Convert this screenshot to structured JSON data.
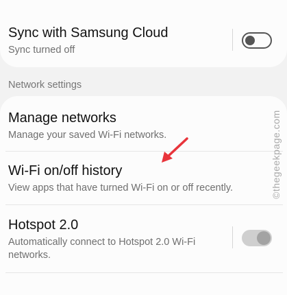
{
  "sync": {
    "title": "Sync with Samsung Cloud",
    "subtitle": "Sync turned off",
    "enabled": false
  },
  "network_section": {
    "header": "Network settings"
  },
  "items": [
    {
      "title": "Manage networks",
      "subtitle": "Manage your saved Wi-Fi networks."
    },
    {
      "title": "Wi-Fi on/off history",
      "subtitle": "View apps that have turned Wi-Fi on or off recently."
    },
    {
      "title": "Hotspot 2.0",
      "subtitle_line1": "Automatically connect to Hotspot 2.0 Wi-Fi",
      "subtitle_line2": "networks.",
      "enabled": true
    }
  ],
  "watermark": "©thegeekpage.com",
  "colors": {
    "arrow": "#e8343b",
    "toggle_on": "#a3a3a3",
    "toggle_off": "#555555"
  }
}
